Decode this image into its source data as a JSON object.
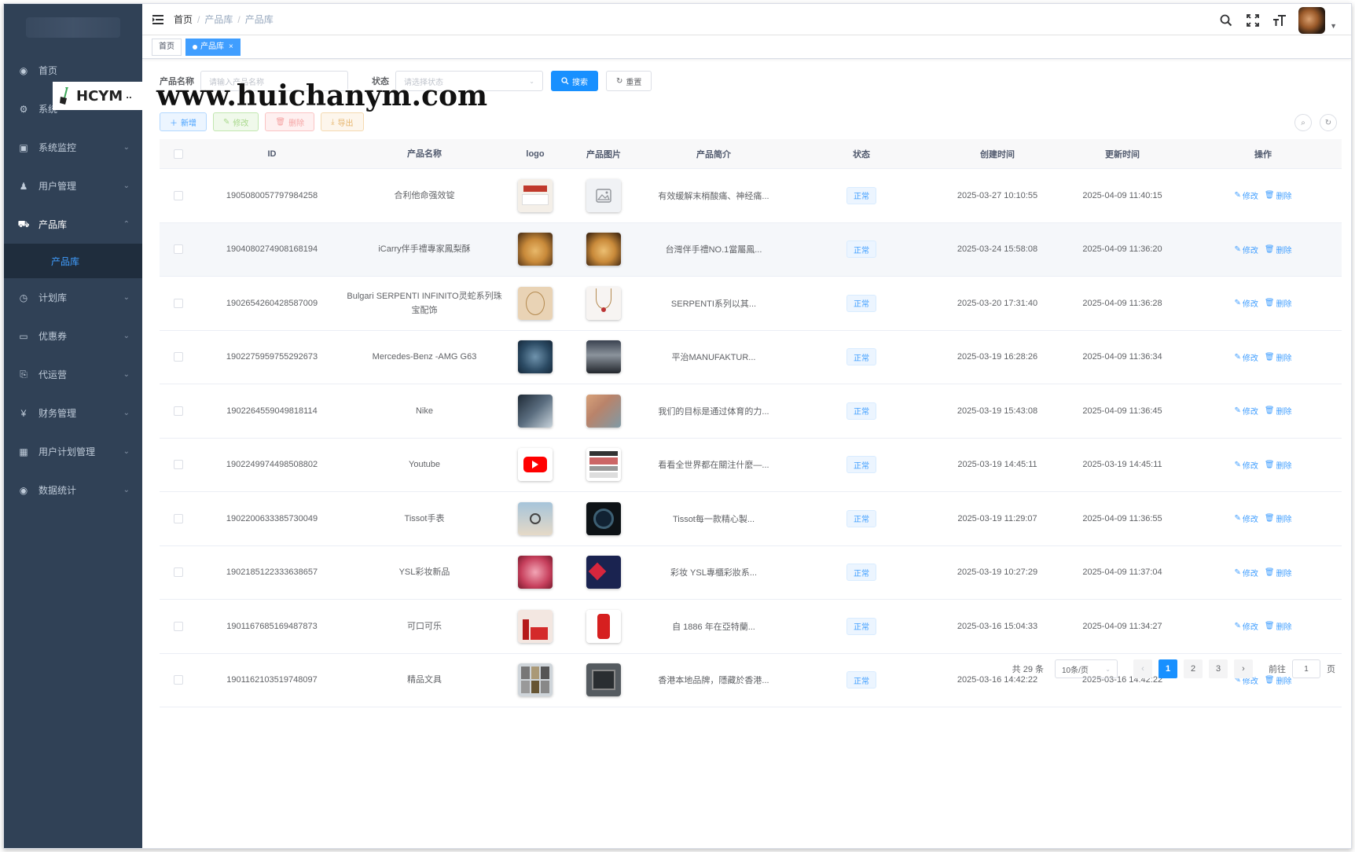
{
  "sidebar": {
    "items": [
      {
        "label": "首页",
        "icon": "dashboard-icon",
        "glyph": "◉"
      },
      {
        "label": "系统",
        "icon": "gear-icon",
        "glyph": "⚙"
      },
      {
        "label": "系统监控",
        "icon": "monitor-icon",
        "glyph": "▣"
      },
      {
        "label": "用户管理",
        "icon": "user-icon",
        "glyph": "♟"
      },
      {
        "label": "产品库",
        "icon": "cart-icon",
        "glyph": "⛟"
      },
      {
        "label": "计划库",
        "icon": "clock-icon",
        "glyph": "◷"
      },
      {
        "label": "优惠券",
        "icon": "coupon-icon",
        "glyph": "▭"
      },
      {
        "label": "代运营",
        "icon": "doc-icon",
        "glyph": "⎘"
      },
      {
        "label": "财务管理",
        "icon": "yen-icon",
        "glyph": "¥"
      },
      {
        "label": "用户计划管理",
        "icon": "table-icon",
        "glyph": "▦"
      },
      {
        "label": "数据统计",
        "icon": "chart-icon",
        "glyph": "◉"
      }
    ],
    "sub_active": "产品库"
  },
  "breadcrumb": [
    "首页",
    "产品库",
    "产品库"
  ],
  "tags": {
    "home": "首页",
    "active": "产品库",
    "close": "×"
  },
  "search": {
    "name_label": "产品名称",
    "name_placeholder": "请输入产品名称",
    "status_label": "状态",
    "status_placeholder": "请选择状态",
    "search_btn": "搜索",
    "reset_btn": "重置"
  },
  "toolbar": {
    "add": "新增",
    "edit": "修改",
    "delete": "删除",
    "export": "导出"
  },
  "watermark": {
    "brand": "HCYM",
    "url": "www.huichanym.com"
  },
  "table": {
    "headers": [
      "ID",
      "产品名称",
      "logo",
      "产品图片",
      "产品简介",
      "状态",
      "创建时间",
      "更新时间",
      "操作"
    ],
    "edit_label": "修改",
    "delete_label": "删除",
    "rows": [
      {
        "id": "1905080057797984258",
        "name": "合利他命强效锭",
        "intro": "有效缓解末梢酸痛、神经痛...",
        "status": "正常",
        "created": "2025-03-27 10:10:55",
        "updated": "2025-04-09 11:40:15"
      },
      {
        "id": "1904080274908168194",
        "name": "iCarry伴手禮專家鳳梨酥",
        "intro": "台灣伴手禮NO.1當屬鳳...",
        "status": "正常",
        "created": "2025-03-24 15:58:08",
        "updated": "2025-04-09 11:36:20"
      },
      {
        "id": "1902654260428587009",
        "name": "Bulgari SERPENTI INFINITO灵蛇系列珠宝配饰",
        "intro": "SERPENTI系列以其...",
        "status": "正常",
        "created": "2025-03-20 17:31:40",
        "updated": "2025-04-09 11:36:28"
      },
      {
        "id": "1902275959755292673",
        "name": "Mercedes-Benz -AMG G63",
        "intro": "平治MANUFAKTUR...",
        "status": "正常",
        "created": "2025-03-19 16:28:26",
        "updated": "2025-04-09 11:36:34"
      },
      {
        "id": "1902264559049818114",
        "name": "Nike",
        "intro": "我们的目标是通过体育的力...",
        "status": "正常",
        "created": "2025-03-19 15:43:08",
        "updated": "2025-04-09 11:36:45"
      },
      {
        "id": "1902249974498508802",
        "name": "Youtube",
        "intro": "看看全世界都在關注什麼—...",
        "status": "正常",
        "created": "2025-03-19 14:45:11",
        "updated": "2025-03-19 14:45:11"
      },
      {
        "id": "1902200633385730049",
        "name": "Tissot手表",
        "intro": "Tissot每一款精心製...",
        "status": "正常",
        "created": "2025-03-19 11:29:07",
        "updated": "2025-04-09 11:36:55"
      },
      {
        "id": "1902185122333638657",
        "name": "YSL彩妆新品",
        "intro": "彩妆 YSL專櫃彩妝系...",
        "status": "正常",
        "created": "2025-03-19 10:27:29",
        "updated": "2025-04-09 11:37:04"
      },
      {
        "id": "1901167685169487873",
        "name": "可口可乐",
        "intro": "自 1886 年在亞特蘭...",
        "status": "正常",
        "created": "2025-03-16 15:04:33",
        "updated": "2025-04-09 11:34:27"
      },
      {
        "id": "1901162103519748097",
        "name": "精品文具",
        "intro": "香港本地品牌，隱藏於香港...",
        "status": "正常",
        "created": "2025-03-16 14:42:22",
        "updated": "2025-03-16 14:42:22"
      }
    ]
  },
  "pagination": {
    "total": "共 29 条",
    "page_size": "10条/页",
    "pages": [
      "1",
      "2",
      "3"
    ],
    "current": "1",
    "goto_label": "前往",
    "goto_value": "1",
    "page_unit": "页"
  }
}
